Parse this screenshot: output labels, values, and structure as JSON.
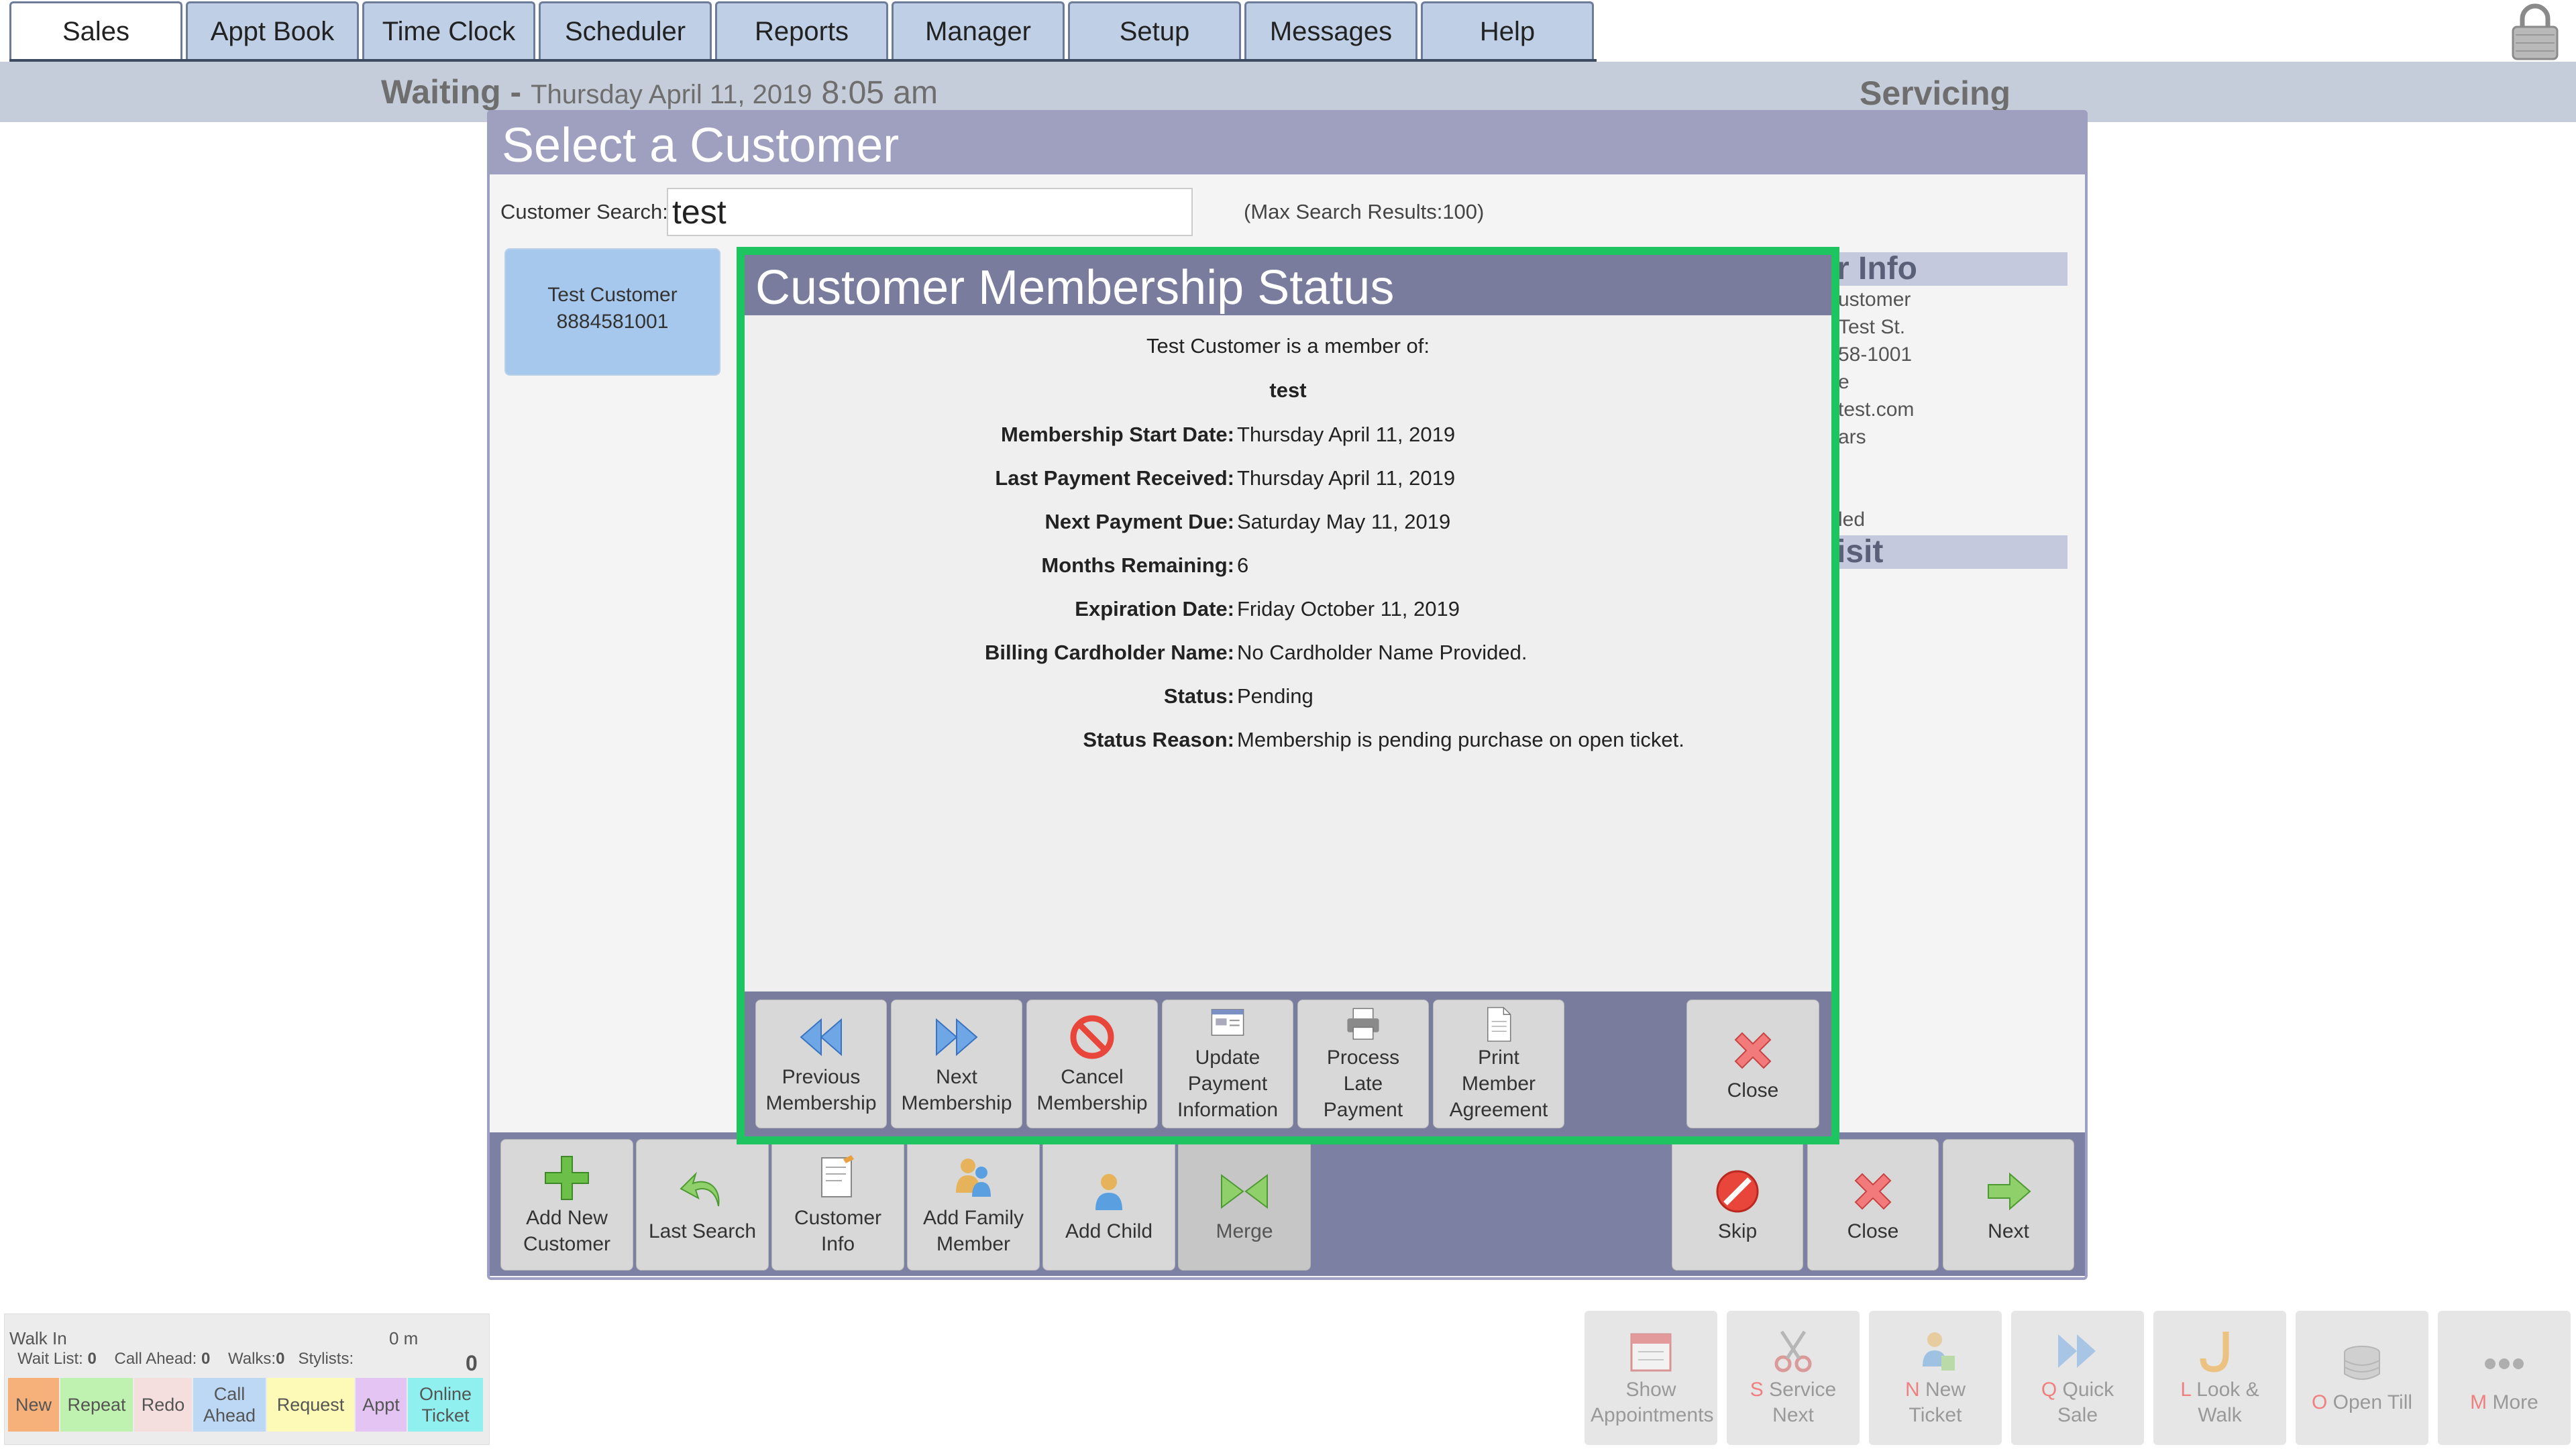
{
  "tabs": [
    "Sales",
    "Appt Book",
    "Time Clock",
    "Scheduler",
    "Reports",
    "Manager",
    "Setup",
    "Messages",
    "Help"
  ],
  "status": {
    "waiting_label": "Waiting -",
    "date": "Thursday April 11, 2019",
    "time": "8:05 am",
    "servicing_label": "Servicing"
  },
  "select_customer": {
    "title": "Select a Customer",
    "search_label": "Customer Search:",
    "search_value": "test",
    "max_results": "(Max Search Results:100)",
    "result": {
      "name": "Test Customer",
      "phone": "8884581001"
    },
    "info_header": "r Info",
    "info_lines": [
      "ustomer",
      "Test St.",
      "58-1001",
      "e",
      "test.com",
      "ars",
      "led"
    ],
    "visit_header": "isit",
    "buttons": {
      "add_new": "Add New Customer",
      "last_search": "Last Search",
      "customer_info": "Customer Info",
      "add_family": "Add Family Member",
      "add_child": "Add Child",
      "merge": "Merge",
      "skip": "Skip",
      "close": "Close",
      "next": "Next"
    }
  },
  "membership": {
    "title": "Customer Membership Status",
    "member_of": "Test Customer is a member of:",
    "membership_name": "test",
    "fields": [
      {
        "label": "Membership Start Date:",
        "value": "Thursday April 11, 2019"
      },
      {
        "label": "Last Payment Received:",
        "value": "Thursday April 11, 2019"
      },
      {
        "label": "Next Payment Due:",
        "value": "Saturday May 11, 2019"
      },
      {
        "label": "Months Remaining:",
        "value": "6"
      },
      {
        "label": "Expiration Date:",
        "value": "Friday October 11, 2019"
      },
      {
        "label": "Billing Cardholder Name:",
        "value": "No Cardholder Name Provided."
      },
      {
        "label": "Status:",
        "value": "Pending"
      },
      {
        "label": "Status Reason:",
        "value": "Membership is pending purchase on open ticket."
      }
    ],
    "buttons": {
      "previous": "Previous Membership",
      "next": "Next Membership",
      "cancel": "Cancel Membership",
      "update_payment": "Update Payment Information",
      "late_payment": "Process Late Payment",
      "print_agreement": "Print Member Agreement",
      "close": "Close"
    }
  },
  "walkin": {
    "title": "Walk In",
    "elapsed": "0 m",
    "wait_list_label": "Wait List:",
    "wait_list": "0",
    "call_ahead_label": "Call Ahead:",
    "call_ahead": "0",
    "walks_label": "Walks:",
    "walks": "0",
    "stylists_label": "Stylists:",
    "total": "0",
    "buttons": [
      "New",
      "Repeat",
      "Redo",
      "Call Ahead",
      "Request",
      "Appt",
      "Online Ticket"
    ],
    "button_colors": [
      "#f6b07a",
      "#bff2b0",
      "#f5dede",
      "#bcd8f5",
      "#fdfab8",
      "#e3c4f3",
      "#8ff0ef"
    ]
  },
  "footer_buttons": [
    {
      "key": "",
      "label": "Show Appointments",
      "icon": "calendar-icon"
    },
    {
      "key": "S",
      "label": "Service Next",
      "icon": "scissors-icon"
    },
    {
      "key": "N",
      "label": "New Ticket",
      "icon": "ticket-person-icon"
    },
    {
      "key": "Q",
      "label": "Quick Sale",
      "icon": "fast-forward-icon"
    },
    {
      "key": "L",
      "label": "Look & Walk",
      "icon": "hook-icon"
    },
    {
      "key": "O",
      "label": "Open Till",
      "icon": "coin-stack-icon"
    },
    {
      "key": "M",
      "label": "More",
      "icon": "dots-icon"
    }
  ]
}
